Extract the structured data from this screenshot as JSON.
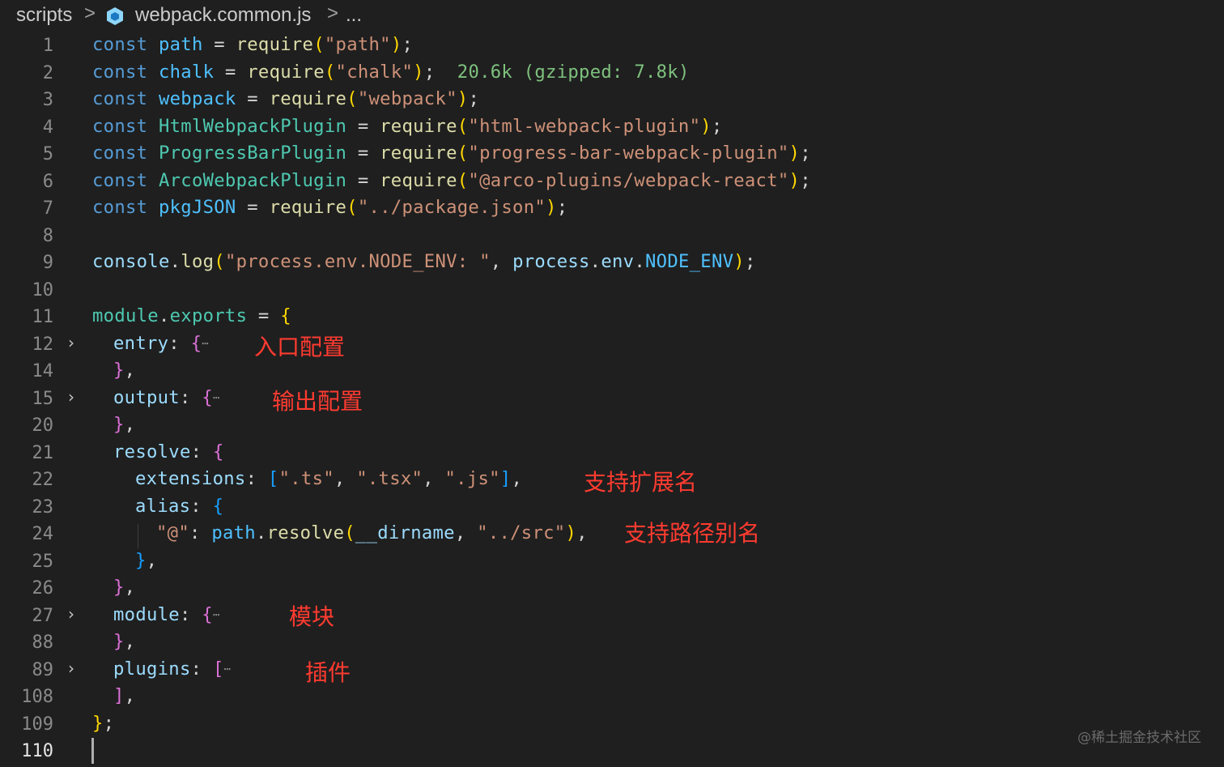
{
  "breadcrumb": {
    "folder": "scripts",
    "file": "webpack.common.js",
    "more": "...",
    "file_icon": "webpack-cube-icon",
    "sep": ">"
  },
  "import_hint": "20.6k (gzipped: 7.8k)",
  "lines": [
    {
      "num": "1"
    },
    {
      "num": "2"
    },
    {
      "num": "3"
    },
    {
      "num": "4"
    },
    {
      "num": "5"
    },
    {
      "num": "6"
    },
    {
      "num": "7"
    },
    {
      "num": "8"
    },
    {
      "num": "9"
    },
    {
      "num": "10"
    },
    {
      "num": "11"
    },
    {
      "num": "12"
    },
    {
      "num": "14"
    },
    {
      "num": "15"
    },
    {
      "num": "20"
    },
    {
      "num": "21"
    },
    {
      "num": "22"
    },
    {
      "num": "23"
    },
    {
      "num": "24"
    },
    {
      "num": "25"
    },
    {
      "num": "26"
    },
    {
      "num": "27"
    },
    {
      "num": "88"
    },
    {
      "num": "89"
    },
    {
      "num": "108"
    },
    {
      "num": "109"
    },
    {
      "num": "110"
    }
  ],
  "code": {
    "kw_const": "const",
    "id_path": "path",
    "id_chalk": "chalk",
    "id_webpack": "webpack",
    "id_html": "HtmlWebpackPlugin",
    "id_progress": "ProgressBarPlugin",
    "id_arco": "ArcoWebpackPlugin",
    "id_pkg": "pkgJSON",
    "fn_require": "require",
    "s_path": "\"path\"",
    "s_chalk": "\"chalk\"",
    "s_webpack": "\"webpack\"",
    "s_html": "\"html-webpack-plugin\"",
    "s_progress": "\"progress-bar-webpack-plugin\"",
    "s_arco": "\"@arco-plugins/webpack-react\"",
    "s_pkg": "\"../package.json\"",
    "console": "console",
    "log": "log",
    "s_env": "\"process.env.NODE_ENV: \"",
    "process": "process",
    "env": "env",
    "node_env": "NODE_ENV",
    "module": "module",
    "exports": "exports",
    "entry": "entry",
    "output": "output",
    "resolve": "resolve",
    "extensions": "extensions",
    "s_ts": "\".ts\"",
    "s_tsx": "\".tsx\"",
    "s_js": "\".js\"",
    "alias": "alias",
    "s_at": "\"@\"",
    "fn_resolve": "resolve",
    "dirname": "__dirname",
    "s_src": "\"../src\"",
    "mod_key": "module",
    "plugins": "plugins",
    "ellipsis": "⋯"
  },
  "annotations": {
    "entry": "入口配置",
    "output": "输出配置",
    "extensions": "支持扩展名",
    "alias": "支持路径别名",
    "module": "模块",
    "plugins": "插件"
  },
  "watermark": "@稀土掘金技术社区",
  "colors": {
    "background": "#1f1f1f",
    "keyword": "#569cd6",
    "string": "#ce9178",
    "function": "#dcdcaa",
    "class": "#4ec9b0",
    "annotation": "#ff3b30",
    "folded_line_bg": "#1d2a38"
  }
}
